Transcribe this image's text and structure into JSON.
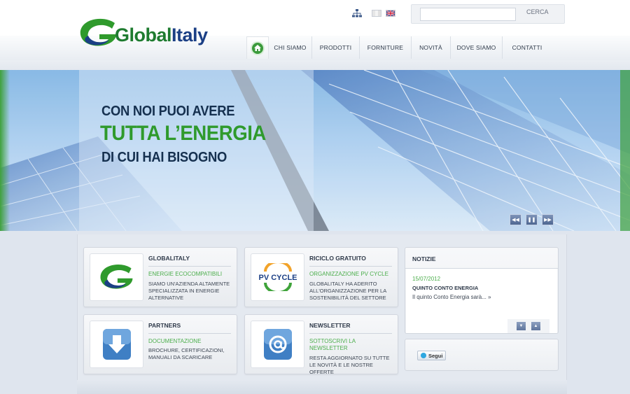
{
  "brand": {
    "logo_global": "Global",
    "logo_italy": "Italy",
    "green": "#2f9a2c",
    "navy": "#1b3f85"
  },
  "header": {
    "icons": [
      "sitemap-icon",
      "flag-italy-icon",
      "flag-uk-icon"
    ],
    "search": {
      "value": "",
      "placeholder": "",
      "button_label": "CERCA"
    }
  },
  "nav": {
    "home_icon": "home-icon",
    "items": [
      {
        "label": "CHI SIAMO"
      },
      {
        "label": "PRODOTTI"
      },
      {
        "label": "FORNITURE"
      },
      {
        "label": "NOVITÀ"
      },
      {
        "label": "DOVE SIAMO"
      },
      {
        "label": "CONTATTI"
      }
    ]
  },
  "hero": {
    "line1": "CON NOI PUOI AVERE",
    "line2": "TUTTA L’ENERGIA",
    "line3": "DI CUI HAI BISOGNO",
    "controls": [
      "previous-icon",
      "pause-icon",
      "next-icon"
    ]
  },
  "cards": [
    {
      "title": "GLOBALITALY",
      "subtitle": "ENERGIE ECOCOMPATIBILI",
      "text": "SIAMO UN'AZIENDA ALTAMENTE SPECIALIZZATA IN ENERGIE ALTERNATIVE",
      "icon": "globalitaly-logo-icon"
    },
    {
      "title": "RICICLO GRATUITO",
      "subtitle": "ORGANIZZAZIONE PV CYCLE",
      "text": "GLOBALITALY HA ADERITO ALL'ORGANIZZAZIONE PER LA SOSTENIBILITÀ DEL SETTORE",
      "icon": "pv-cycle-logo-icon",
      "logo_text": "PV CYCLE"
    },
    {
      "title": "PARTNERS",
      "subtitle": "DOCUMENTAZIONE",
      "text": "BROCHURE, CERTIFICAZIONI, MANUALI DA SCARICARE",
      "icon": "download-icon"
    },
    {
      "title": "NEWSLETTER",
      "subtitle": "SOTTOSCRIVI LA NEWSLETTER",
      "text": "RESTA AGGIORNATO SU TUTTE LE NOVITÀ E LE NOSTRE OFFERTE",
      "icon": "email-at-icon"
    }
  ],
  "news": {
    "title": "NOTIZIE",
    "date": "15/07/2012",
    "headline": "QUINTO CONTO ENERGIA",
    "excerpt": "Il quinto Conto Energia sarà... »",
    "controls": [
      "arrow-down-icon",
      "arrow-up-icon"
    ]
  },
  "social": {
    "follow_label": "Segui",
    "icon": "twitter-icon"
  }
}
